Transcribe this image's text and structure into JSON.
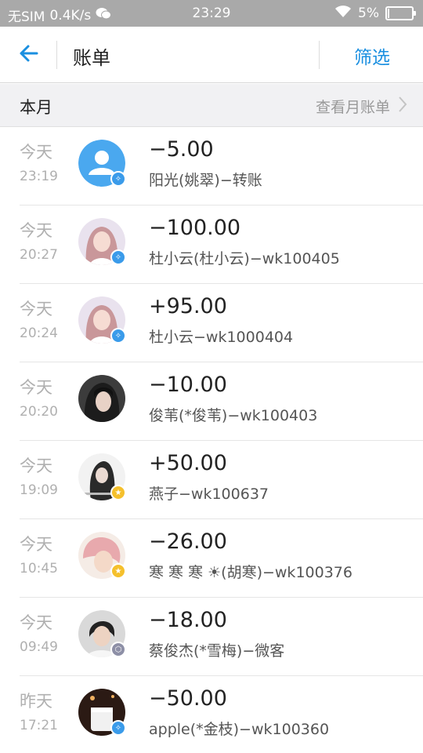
{
  "status_bar": {
    "carrier": "无SIM",
    "speed": "0.4K/s",
    "time": "23:29",
    "battery": "5%",
    "battery_level": 0.05
  },
  "nav": {
    "title": "账单",
    "filter_label": "筛选"
  },
  "month": {
    "label": "本月",
    "link_label": "查看月账单"
  },
  "transactions": [
    {
      "day": "今天",
      "time": "23:19",
      "amount": "−5.00",
      "desc": "阳光(姚翠)−转账",
      "avatar_icon": "default-user-icon",
      "badge": "verified-badge-icon",
      "badge_color": "#3a9bea"
    },
    {
      "day": "今天",
      "time": "20:27",
      "amount": "−100.00",
      "desc": "杜小云(杜小云)−wk100405",
      "avatar_icon": "photo-avatar",
      "badge": "verified-badge-icon",
      "badge_color": "#3a9bea"
    },
    {
      "day": "今天",
      "time": "20:24",
      "amount": "+95.00",
      "desc": "杜小云−wk1000404",
      "avatar_icon": "photo-avatar",
      "badge": "verified-badge-icon",
      "badge_color": "#3a9bea"
    },
    {
      "day": "今天",
      "time": "20:20",
      "amount": "−10.00",
      "desc": "俊苇(*俊苇)−wk100403",
      "avatar_icon": "photo-avatar",
      "badge": "",
      "badge_color": ""
    },
    {
      "day": "今天",
      "time": "19:09",
      "amount": "+50.00",
      "desc": "燕子−wk100637",
      "avatar_icon": "photo-avatar",
      "badge": "star-badge-icon",
      "badge_color": "#f5c02c"
    },
    {
      "day": "今天",
      "time": "10:45",
      "amount": "−26.00",
      "desc": "寒 寒 寒 ☀(胡寒)−wk100376",
      "avatar_icon": "photo-avatar",
      "badge": "star-badge-icon",
      "badge_color": "#f5c02c"
    },
    {
      "day": "今天",
      "time": "09:49",
      "amount": "−18.00",
      "desc": "蔡俊杰(*雪梅)−微客",
      "avatar_icon": "photo-avatar",
      "badge": "hexagon-badge-icon",
      "badge_color": "#8d8fa6"
    },
    {
      "day": "昨天",
      "time": "17:21",
      "amount": "−50.00",
      "desc": "apple(*金枝)−wk100360",
      "avatar_icon": "photo-avatar",
      "badge": "verified-badge-icon",
      "badge_color": "#3a9bea"
    }
  ],
  "colors": {
    "accent": "#1a8fe0",
    "status_bar_bg": "#a9a9a9",
    "month_bar_bg": "#f1f1f3"
  }
}
